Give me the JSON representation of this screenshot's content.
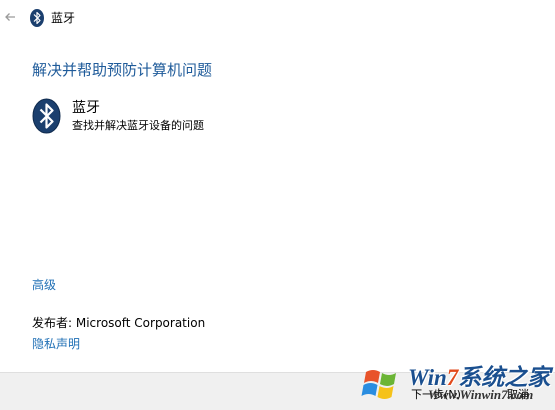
{
  "window": {
    "title": "蓝牙"
  },
  "main": {
    "heading": "解决并帮助预防计算机问题",
    "item": {
      "title": "蓝牙",
      "description": "查找并解决蓝牙设备的问题"
    },
    "advanced_link": "高级",
    "publisher_label": "发布者: ",
    "publisher_name": "Microsoft Corporation",
    "privacy_link": "隐私声明"
  },
  "footer": {
    "next_label": "下一步(N)",
    "cancel_label": "取消"
  },
  "watermark": {
    "brand_prefix": "Win",
    "brand_number": "7",
    "brand_suffix": "系统之家",
    "url": "Www.Winwin7.com"
  },
  "colors": {
    "heading": "#1f5b9a",
    "link": "#1f6fb5",
    "bluetooth_badge": "#1b3f6e",
    "footer_bg": "#f0f0f0"
  },
  "icons": {
    "back": "arrow-left-icon",
    "bluetooth": "bluetooth-icon"
  }
}
